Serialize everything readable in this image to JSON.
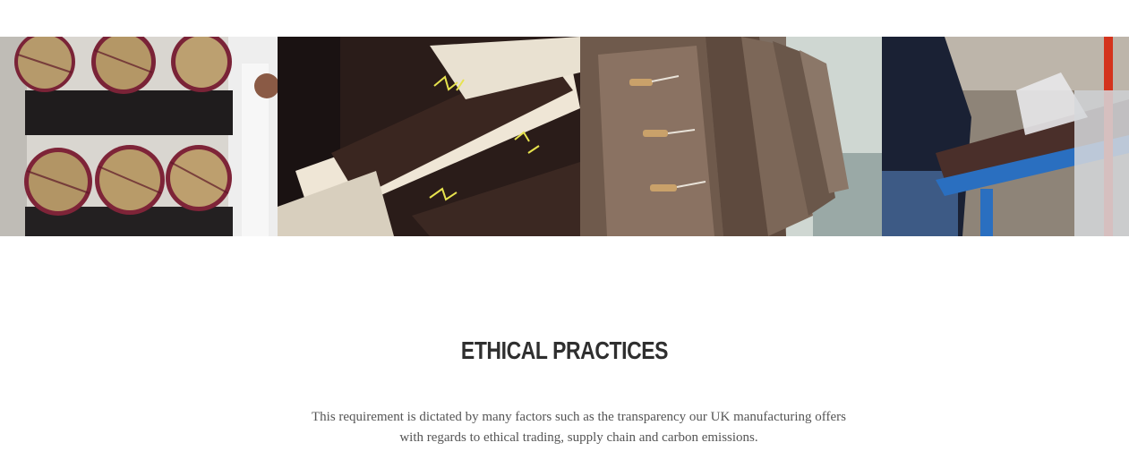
{
  "gallery": {
    "images": [
      {
        "name": "fabric-rolls-photo",
        "subject": "rolls of wrapped fabric stacked in warehouse"
      },
      {
        "name": "tagged-cloth-photo",
        "subject": "brown cloth bolts with yellow chalk markings"
      },
      {
        "name": "duffle-coats-photo",
        "subject": "brown duffle coats with toggle fastenings on a rail"
      },
      {
        "name": "garment-inspection-photo",
        "subject": "worker handling garments on a blue work table"
      }
    ]
  },
  "section": {
    "title": "ETHICAL PRACTICES",
    "body": "This requirement is dictated by many factors such as the transparency our UK manufacturing offers with regards to ethical trading, supply chain and carbon emissions."
  },
  "colors": {
    "background": "#ffffff",
    "title_text": "#2f2f2f",
    "body_text": "#555555"
  }
}
